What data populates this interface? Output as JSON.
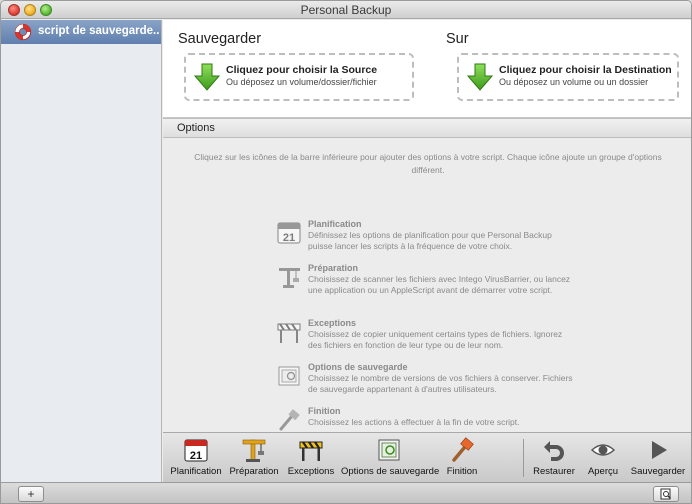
{
  "window": {
    "title": "Personal Backup"
  },
  "sidebar": {
    "items": [
      {
        "label": "script de sauvegarde...",
        "icon": "lifebuoy-icon"
      }
    ]
  },
  "source": {
    "heading": "Sauvegarder",
    "title": "Cliquez pour choisir la Source",
    "subtitle": "Ou déposez un volume/dossier/fichier",
    "icon": "green-down-arrow-icon"
  },
  "destination": {
    "heading": "Sur",
    "title": "Cliquez pour choisir la Destination",
    "subtitle": "Ou déposez un volume ou un dossier",
    "icon": "green-down-arrow-icon"
  },
  "options": {
    "header": "Options",
    "intro": "Cliquez sur les icônes de la barre inférieure pour ajouter des options à votre script. Chaque icône ajoute un groupe d'options différent.",
    "items": [
      {
        "name": "Planification",
        "desc": "Définissez les options de planification pour que Personal Backup puisse lancer les scripts à la fréquence de votre choix.",
        "icon": "calendar-icon"
      },
      {
        "name": "Préparation",
        "desc": "Choisissez de scanner les fichiers avec Intego VirusBarrier, ou lancez une application ou un AppleScript avant de démarrer votre script.",
        "icon": "crane-icon"
      },
      {
        "name": "Exceptions",
        "desc": "Choisissez de copier uniquement certains types de fichiers. Ignorez des fichiers en fonction de leur type ou de leur nom.",
        "icon": "barrier-icon"
      },
      {
        "name": "Options de sauvegarde",
        "desc": "Choisissez le nombre de versions de vos fichiers à conserver. Fichiers de sauvegarde appartenant à d'autres utilisateurs.",
        "icon": "versions-icon"
      },
      {
        "name": "Finition",
        "desc": "Choisissez les actions à effectuer à la fin de votre script.",
        "icon": "paintbrush-icon"
      }
    ]
  },
  "calendar_day": "21",
  "toolbar": {
    "planification": "Planification",
    "preparation": "Préparation",
    "exceptions": "Exceptions",
    "options_sauvegarde": "Options de sauvegarde",
    "finition": "Finition",
    "restaurer": "Restaurer",
    "apercu": "Aperçu",
    "sauvegarder": "Sauvegarder"
  },
  "bottombar": {
    "add_label": "+"
  },
  "colors": {
    "sidebar_selection": "#6f8cb8",
    "arrow_green": "#52b52e",
    "dropzone_border": "#bdbdbd"
  }
}
